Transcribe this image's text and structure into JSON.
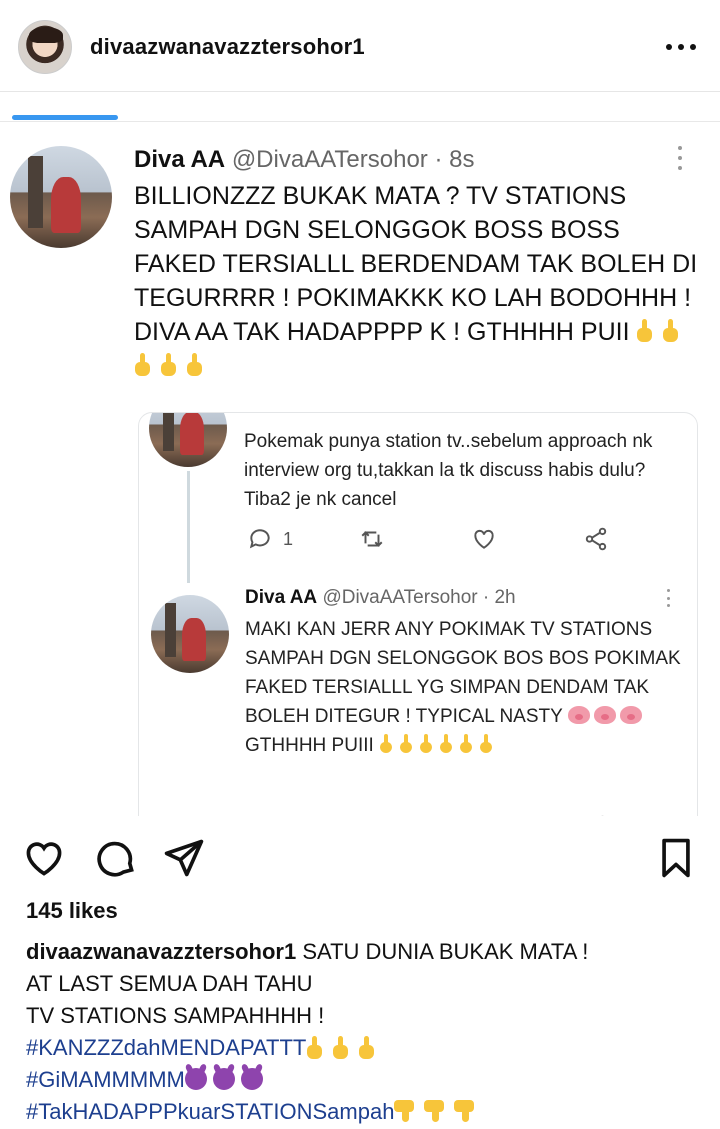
{
  "post": {
    "username": "divaazwanavazztersohor1",
    "likes": "145 likes",
    "caption": {
      "line1": "SATU DUNIA BUKAK MATA !",
      "line2": "AT LAST SEMUA DAH TAHU",
      "line3": "TV STATIONS SAMPAHHHH !",
      "tag1": "#KANZZZdahMENDAPATTT",
      "tag2": "#GiMAMMMMM",
      "tag3": "#TakHADAPPPkuarSTATIONSampah"
    }
  },
  "tweet": {
    "name": "Diva AA",
    "handle": "@DivaAATersohor · 8s",
    "text": "BILLIONZZZ BUKAK MATA ? TV STATIONS SAMPAH DGN SELONGGOK BOSS BOSS FAKED TERSIALLL BERDENDAM TAK BOLEH DI TEGURRRR ! POKIMAKKK KO LAH BODOHHH ! DIVA AA TAK HADAPPPP K ! GTHHHH PUII"
  },
  "quoted": {
    "reply1": {
      "text": "Pokemak punya station tv..sebelum approach nk interview org tu,takkan la tk discuss habis dulu? Tiba2 je nk cancel",
      "reply_count": "1"
    },
    "reply2": {
      "name": "Diva AA",
      "handle": "@DivaAATersohor · 2h",
      "text_main": "MAKI KAN JERR ANY POKIMAK TV STATIONS SAMPAH DGN SELONGGOK BOS BOS POKIMAK FAKED TERSIALLL YG SIMPAN DENDAM TAK BOLEH DITEGUR ! TYPICAL NASTY",
      "text_tail": "GTHHHH PUIII"
    }
  },
  "icons": {
    "heart": "heart-icon",
    "comment": "comment-icon",
    "share": "paper-plane-icon",
    "save": "bookmark-icon",
    "emoji_middle_finger": "middle-finger-emoji",
    "emoji_pig": "pig-face-emoji",
    "emoji_devil": "angry-devil-emoji",
    "emoji_thumbs_down": "thumbs-down-emoji"
  },
  "colors": {
    "hashtag": "#1d3f8f",
    "carousel_indicator": "#3897f0",
    "emoji_yellow": "#f7c53a"
  }
}
